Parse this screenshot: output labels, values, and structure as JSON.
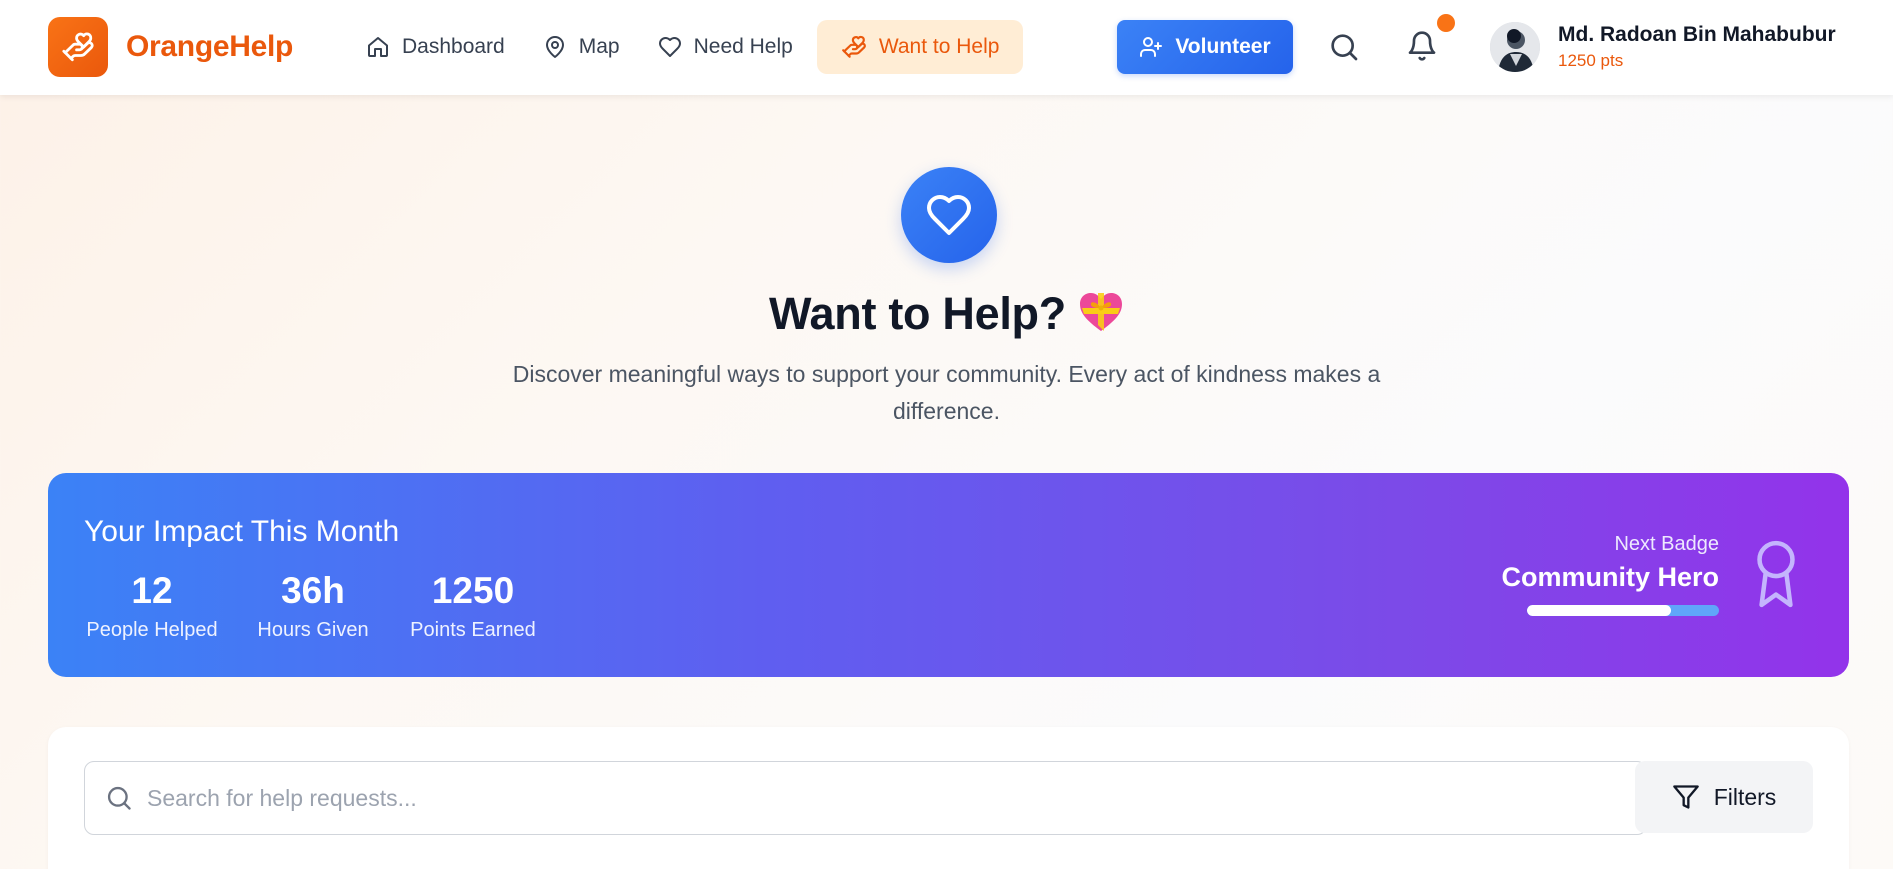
{
  "brand": {
    "name": "OrangeHelp"
  },
  "nav": {
    "items": [
      {
        "label": "Dashboard",
        "icon": "home-icon"
      },
      {
        "label": "Map",
        "icon": "map-pin-icon"
      },
      {
        "label": "Need Help",
        "icon": "heart-icon"
      },
      {
        "label": "Want to Help",
        "icon": "helping-hand-icon",
        "active": true
      }
    ],
    "volunteer_label": "Volunteer"
  },
  "user": {
    "name": "Md. Radoan Bin Mahabubur",
    "points": "1250 pts",
    "has_notification": true
  },
  "hero": {
    "title": "Want to Help?",
    "emoji": "gift-heart",
    "subtitle": "Discover meaningful ways to support your community. Every act of kindness makes a difference."
  },
  "impact": {
    "title": "Your Impact This Month",
    "stats": [
      {
        "value": "12",
        "label": "People Helped"
      },
      {
        "value": "36h",
        "label": "Hours Given"
      },
      {
        "value": "1250",
        "label": "Points Earned"
      }
    ],
    "next_badge_label": "Next Badge",
    "next_badge_name": "Community Hero",
    "badge_progress": 0.75,
    "badge_icon": "award-ribbon-icon"
  },
  "search": {
    "placeholder": "Search for help requests...",
    "value": "",
    "filters_label": "Filters"
  },
  "colors": {
    "brand_orange": "#ea580c",
    "primary_blue": "#2563eb",
    "gradient_end_purple": "#9333ea",
    "active_nav_bg": "#ffedd5"
  }
}
